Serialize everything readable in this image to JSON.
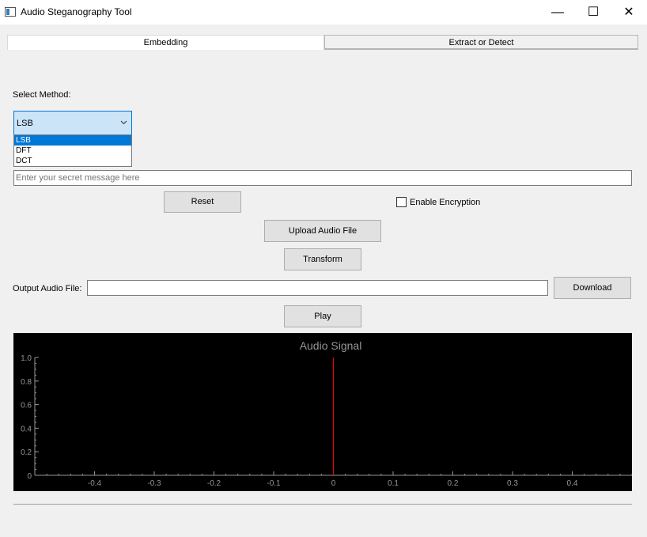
{
  "window": {
    "title": "Audio Steganography Tool",
    "minimize": "—",
    "maximize": "☐",
    "close": "✕"
  },
  "tabs": [
    {
      "label": "Embedding",
      "active": true
    },
    {
      "label": "Extract or Detect",
      "active": false
    }
  ],
  "method": {
    "label": "Select Method:",
    "value": "LSB",
    "options": [
      "LSB",
      "DFT",
      "DCT"
    ],
    "highlighted": "LSB"
  },
  "message": {
    "placeholder": "Enter your secret message here"
  },
  "buttons": {
    "reset": "Reset",
    "upload": "Upload Audio File",
    "transform": "Transform",
    "download": "Download",
    "play": "Play"
  },
  "encryption": {
    "label": "Enable Encryption",
    "checked": false
  },
  "output": {
    "label": "Output Audio File:",
    "value": ""
  },
  "chart_data": {
    "type": "line",
    "title": "Audio Signal",
    "x_ticks": [
      "-0.4",
      "-0.3",
      "-0.2",
      "-0.1",
      "0",
      "0.1",
      "0.2",
      "0.3",
      "0.4"
    ],
    "y_ticks": [
      "0",
      "0.2",
      "0.4",
      "0.6",
      "0.8",
      "1.0"
    ],
    "xlim": [
      -0.5,
      0.5
    ],
    "ylim": [
      0,
      1.0
    ],
    "series": [
      {
        "x": [
          0,
          0
        ],
        "y": [
          0,
          1.0
        ],
        "color": "#ff0000"
      }
    ],
    "background": "#000000",
    "axis_color": "#969696"
  }
}
